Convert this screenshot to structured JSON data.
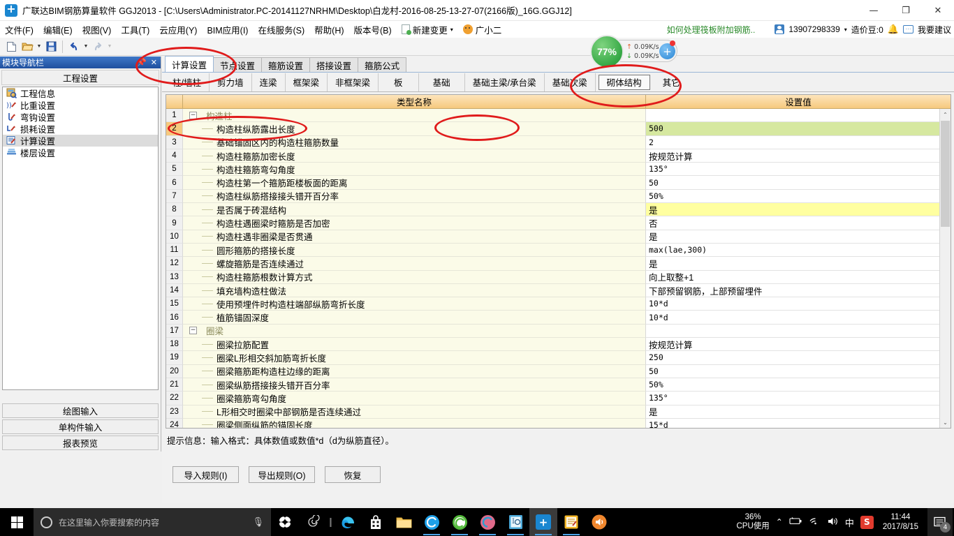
{
  "window": {
    "title": "广联达BIM钢筋算量软件 GGJ2013 - [C:\\Users\\Administrator.PC-20141127NRHM\\Desktop\\白龙村-2016-08-25-13-27-07(2166版)_16G.GGJ12]",
    "minimize": "—",
    "maximize": "❐",
    "close": "✕"
  },
  "menu": {
    "items": [
      {
        "label": "文件(F)"
      },
      {
        "label": "编辑(E)"
      },
      {
        "label": "视图(V)"
      },
      {
        "label": "工具(T)"
      },
      {
        "label": "云应用(Y)"
      },
      {
        "label": "BIM应用(I)"
      },
      {
        "label": "在线服务(S)"
      },
      {
        "label": "帮助(H)"
      },
      {
        "label": "版本号(B)"
      }
    ],
    "new_change": "新建变更",
    "new_change_arrow": "▾",
    "assistant": "广小二",
    "ad_text": "如何处理筏板附加钢筋..",
    "account": "13907298339",
    "account_arrow": "▾",
    "points": "造价豆:0",
    "suggest": "我要建议",
    "suggest_icon_glyph": "···"
  },
  "netwidget": {
    "percent": "77%",
    "upload": "0.09K/s",
    "download": "0.09K/s",
    "up_arrow": "↑",
    "down_arrow": "↓",
    "plus": "+"
  },
  "leftpanel": {
    "caption": "模块导航栏",
    "pin": "📌",
    "close": "✕",
    "header": "工程设置",
    "items": [
      {
        "label": "工程信息",
        "selected": false
      },
      {
        "label": "比重设置",
        "selected": false
      },
      {
        "label": "弯钩设置",
        "selected": false
      },
      {
        "label": "损耗设置",
        "selected": false
      },
      {
        "label": "计算设置",
        "selected": true
      },
      {
        "label": "楼层设置",
        "selected": false
      }
    ],
    "bottom_buttons": [
      {
        "label": "绘图输入"
      },
      {
        "label": "单构件输入"
      },
      {
        "label": "报表预览"
      }
    ]
  },
  "tabs_primary": [
    {
      "label": "计算设置",
      "active": true
    },
    {
      "label": "节点设置",
      "active": false
    },
    {
      "label": "箍筋设置",
      "active": false
    },
    {
      "label": "搭接设置",
      "active": false
    },
    {
      "label": "箍筋公式",
      "active": false
    }
  ],
  "tabs_secondary": [
    {
      "label": "柱/墙柱",
      "active": false
    },
    {
      "label": "剪力墙",
      "active": false
    },
    {
      "label": "连梁",
      "active": false
    },
    {
      "label": "框架梁",
      "active": false
    },
    {
      "label": "非框架梁",
      "active": false
    },
    {
      "label": "板",
      "active": false
    },
    {
      "label": "基础",
      "active": false
    },
    {
      "label": "基础主梁/承台梁",
      "active": false
    },
    {
      "label": "基础次梁",
      "active": false
    },
    {
      "label": "砌体结构",
      "active": true
    },
    {
      "label": "其它",
      "active": false
    }
  ],
  "grid": {
    "headers": {
      "num": "",
      "name": "类型名称",
      "value": "设置值"
    },
    "rows": [
      {
        "num": "1",
        "name": "构造柱",
        "value": "",
        "type": "group",
        "expander": "−"
      },
      {
        "num": "2",
        "name": "构造柱纵筋露出长度",
        "value": "500",
        "type": "leaf",
        "highlight": "green",
        "selected": true
      },
      {
        "num": "3",
        "name": "基础锚固区内的构造柱箍筋数量",
        "value": "2",
        "type": "leaf"
      },
      {
        "num": "4",
        "name": "构造柱箍筋加密长度",
        "value": "按规范计算",
        "type": "leaf",
        "cjk": true
      },
      {
        "num": "5",
        "name": "构造柱箍筋弯勾角度",
        "value": "135°",
        "type": "leaf"
      },
      {
        "num": "6",
        "name": "构造柱第一个箍筋距楼板面的距离",
        "value": "50",
        "type": "leaf"
      },
      {
        "num": "7",
        "name": "构造柱纵筋搭接接头错开百分率",
        "value": "50%",
        "type": "leaf"
      },
      {
        "num": "8",
        "name": "是否属于砖混结构",
        "value": "是",
        "type": "leaf",
        "cjk": true,
        "highlight": "yellow"
      },
      {
        "num": "9",
        "name": "构造柱遇圈梁时箍筋是否加密",
        "value": "否",
        "type": "leaf",
        "cjk": true
      },
      {
        "num": "10",
        "name": "构造柱遇非圈梁是否贯通",
        "value": "是",
        "type": "leaf",
        "cjk": true
      },
      {
        "num": "11",
        "name": "圆形箍筋的搭接长度",
        "value": "max(lae,300)",
        "type": "leaf"
      },
      {
        "num": "12",
        "name": "螺旋箍筋是否连续通过",
        "value": "是",
        "type": "leaf",
        "cjk": true
      },
      {
        "num": "13",
        "name": "构造柱箍筋根数计算方式",
        "value": "向上取整+1",
        "type": "leaf",
        "cjk": true
      },
      {
        "num": "14",
        "name": "填充墙构造柱做法",
        "value": "下部预留钢筋，上部预留埋件",
        "type": "leaf",
        "cjk": true
      },
      {
        "num": "15",
        "name": "使用预埋件时构造柱端部纵筋弯折长度",
        "value": "10*d",
        "type": "leaf"
      },
      {
        "num": "16",
        "name": "植筋锚固深度",
        "value": "10*d",
        "type": "leaf"
      },
      {
        "num": "17",
        "name": "圈梁",
        "value": "",
        "type": "group",
        "expander": "−"
      },
      {
        "num": "18",
        "name": "圈梁拉筋配置",
        "value": "按规范计算",
        "type": "leaf",
        "cjk": true
      },
      {
        "num": "19",
        "name": "圈梁L形相交斜加筋弯折长度",
        "value": "250",
        "type": "leaf"
      },
      {
        "num": "20",
        "name": "圈梁箍筋距构造柱边缘的距离",
        "value": "50",
        "type": "leaf"
      },
      {
        "num": "21",
        "name": "圈梁纵筋搭接接头错开百分率",
        "value": "50%",
        "type": "leaf"
      },
      {
        "num": "22",
        "name": "圈梁箍筋弯勾角度",
        "value": "135°",
        "type": "leaf"
      },
      {
        "num": "23",
        "name": "L形相交时圈梁中部钢筋是否连续通过",
        "value": "是",
        "type": "leaf",
        "cjk": true
      },
      {
        "num": "24",
        "name": "圈梁侧面纵筋的锚固长度",
        "value": "15*d",
        "type": "leaf"
      }
    ],
    "scroll_up": "⌃",
    "scroll_down": "⌄"
  },
  "hint": "提示信息：输入格式：具体数值或数值*d（d为纵筋直径）。",
  "footer_buttons": [
    {
      "label": "导入规则(I)"
    },
    {
      "label": "导出规则(O)"
    },
    {
      "label": "恢复"
    }
  ],
  "taskbar": {
    "search_placeholder": "在这里输入你要搜索的内容",
    "mic": "🎤",
    "cpu_percent": "36%",
    "cpu_label": "CPU使用",
    "tray_chevron": "⌃",
    "ime": "中",
    "ime_app": "S",
    "time": "11:44",
    "date": "2017/8/15",
    "notification_count": "4"
  }
}
